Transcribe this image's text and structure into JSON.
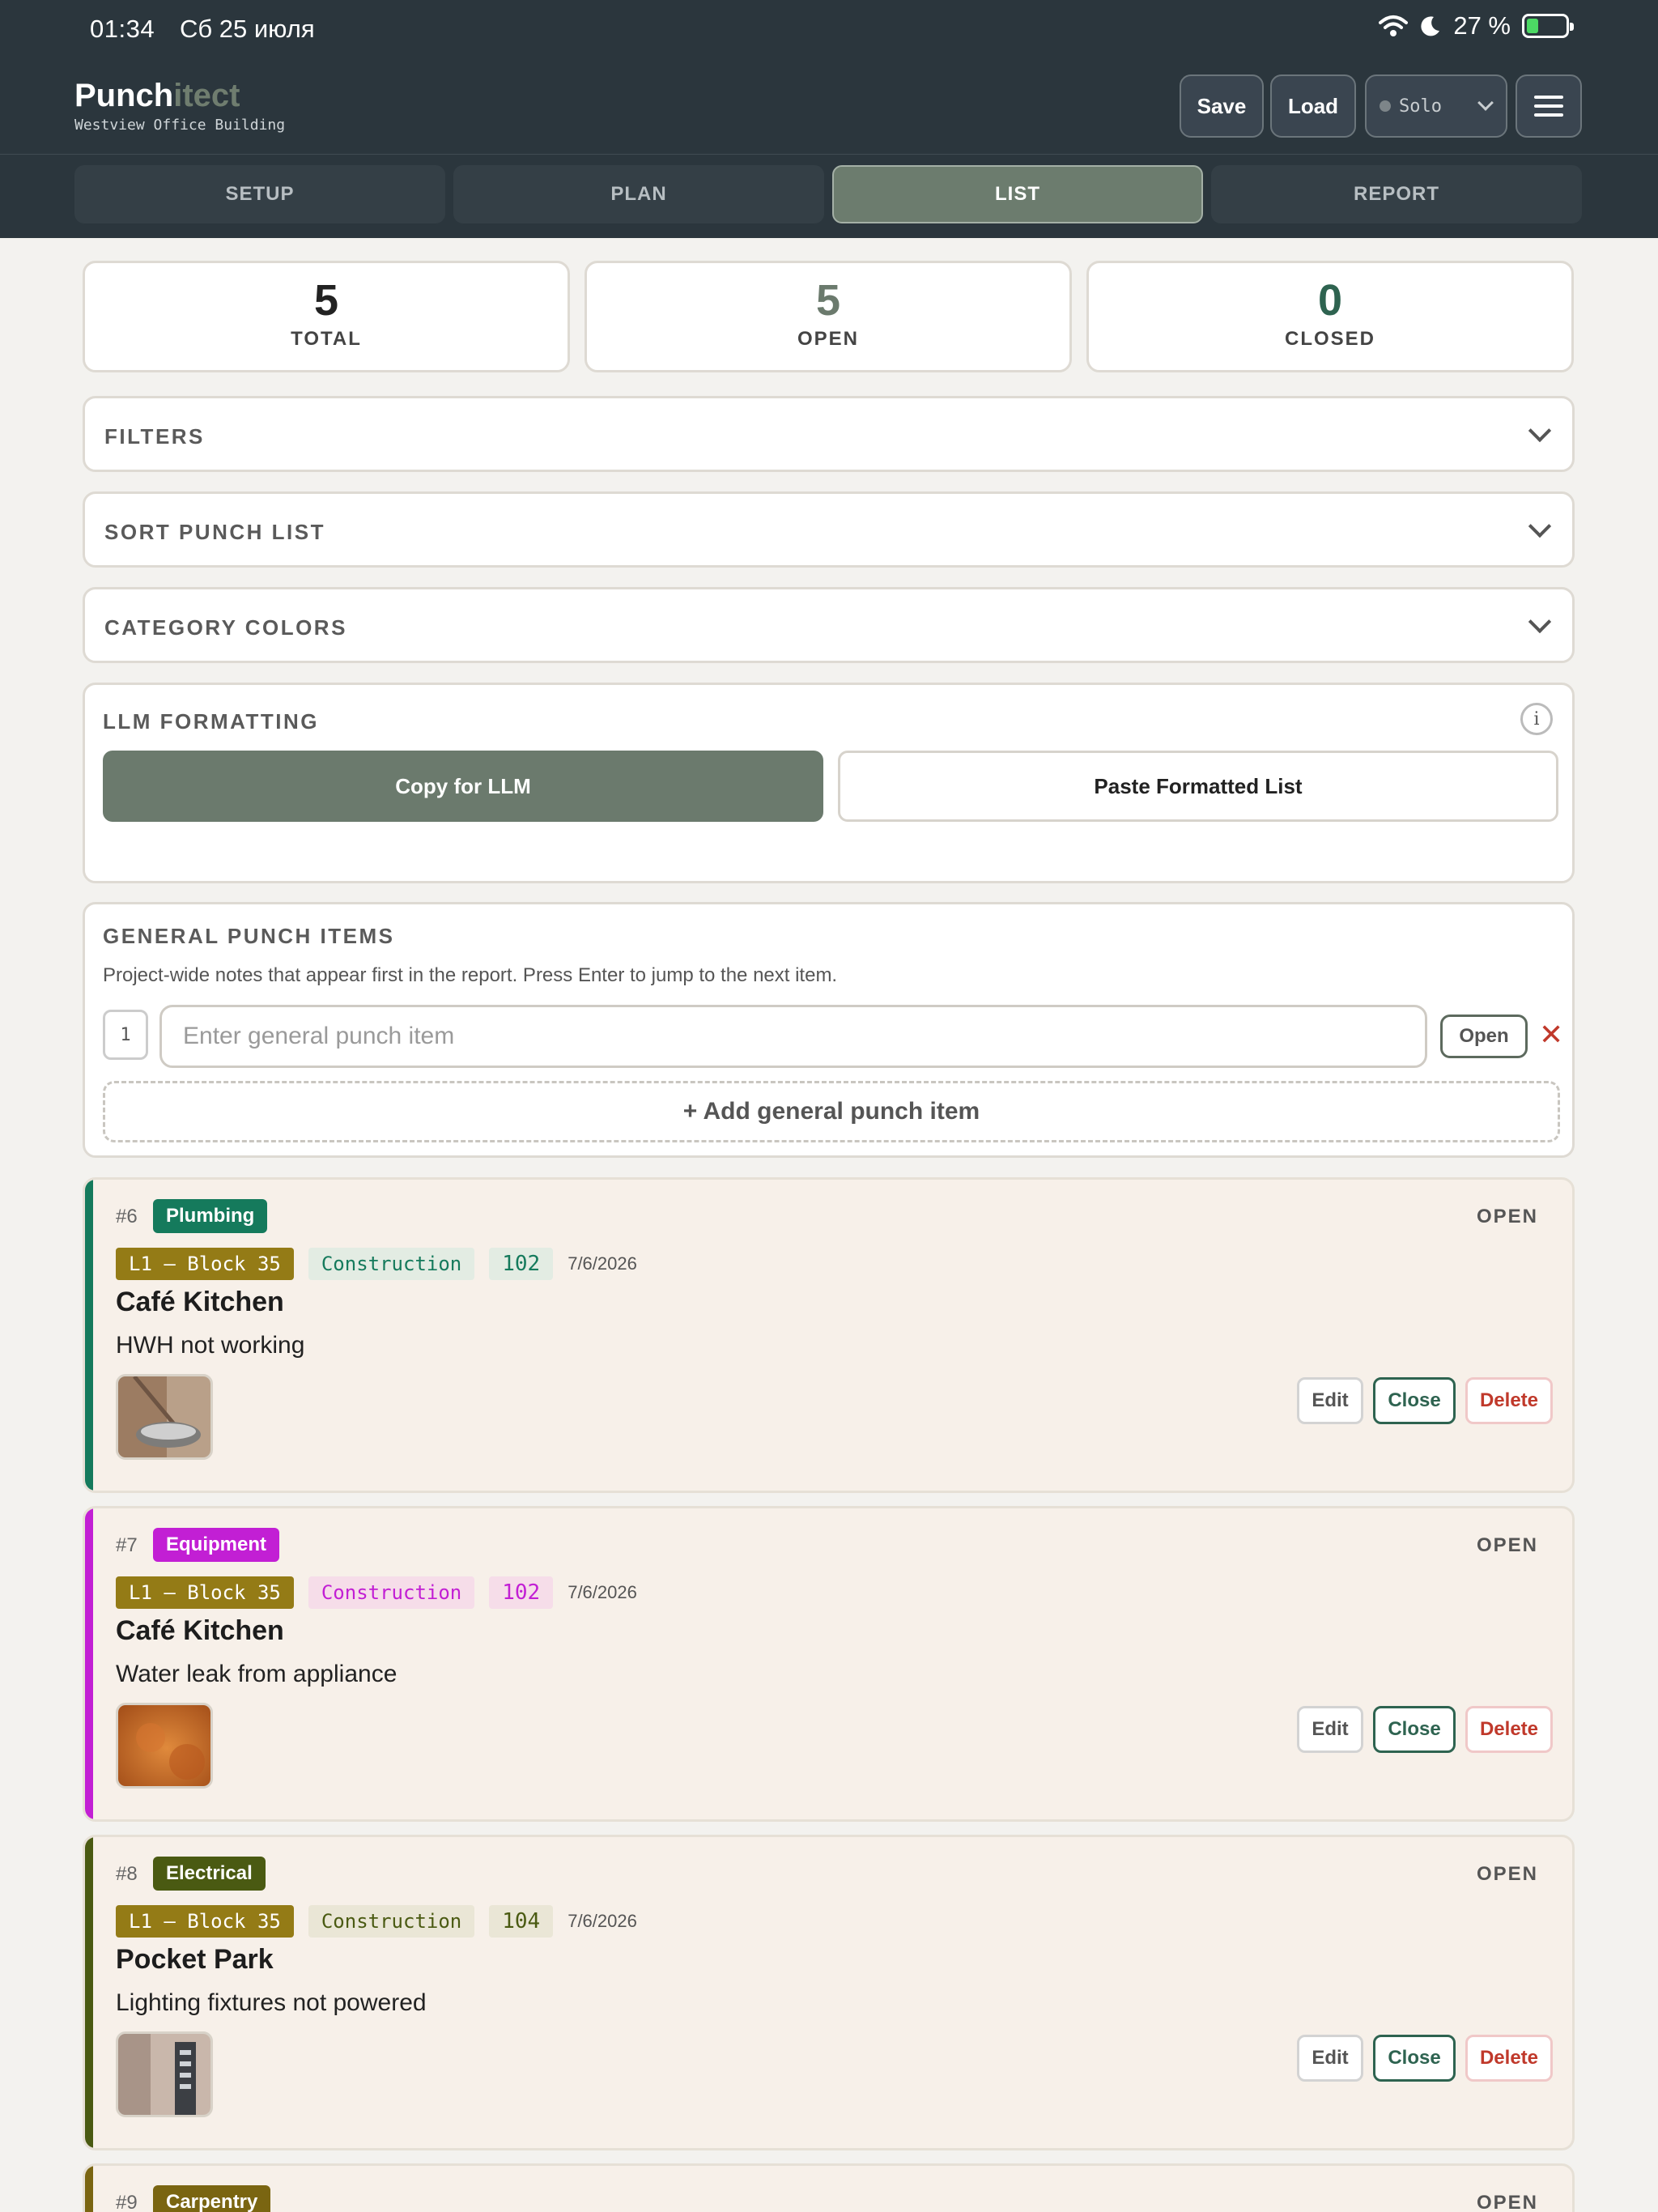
{
  "status": {
    "time": "01:34",
    "date": "Сб 25 июля",
    "battery": "27 %"
  },
  "header": {
    "brand_a": "Punch",
    "brand_b": "itect",
    "subtitle": "Westview Office Building",
    "save": "Save",
    "load": "Load",
    "mode": "Solo"
  },
  "tabs": [
    "SETUP",
    "PLAN",
    "LIST",
    "REPORT"
  ],
  "active_tab": "LIST",
  "stats": [
    {
      "value": "5",
      "label": "TOTAL",
      "color": "#222222"
    },
    {
      "value": "5",
      "label": "OPEN",
      "color": "#6b7a6d"
    },
    {
      "value": "0",
      "label": "CLOSED",
      "color": "#2e6350"
    }
  ],
  "sections": {
    "filters": "FILTERS",
    "sort": "SORT PUNCH LIST",
    "colors": "CATEGORY COLORS"
  },
  "llm": {
    "title": "LLM FORMATTING",
    "info": "i",
    "copy": "Copy for LLM",
    "paste": "Paste Formatted List"
  },
  "general": {
    "title": "GENERAL PUNCH ITEMS",
    "desc": "Project-wide notes that appear first in the report. Press Enter to jump to the next item.",
    "index": "1",
    "placeholder": "Enter general punch item",
    "status": "Open",
    "remove": "✕",
    "add": "+ Add general punch item"
  },
  "actions": {
    "edit": "Edit",
    "close": "Close",
    "delete": "Delete"
  },
  "items": [
    {
      "id": "#6",
      "category": "Plumbing",
      "color": "#157a5c",
      "chip_bg": "#e3ece3",
      "status": "OPEN",
      "location": "L1 – Block 35",
      "phase": "Construction",
      "room": "102",
      "date": "7/6/2026",
      "name": "Café Kitchen",
      "desc": "HWH not working"
    },
    {
      "id": "#7",
      "category": "Equipment",
      "color": "#c21fd4",
      "chip_bg": "#f6dde9",
      "status": "OPEN",
      "location": "L1 – Block 35",
      "phase": "Construction",
      "room": "102",
      "date": "7/6/2026",
      "name": "Café Kitchen",
      "desc": "Water leak from appliance"
    },
    {
      "id": "#8",
      "category": "Electrical",
      "color": "#4a5a12",
      "chip_bg": "#eae6d6",
      "status": "OPEN",
      "location": "L1 – Block 35",
      "phase": "Construction",
      "room": "104",
      "date": "7/6/2026",
      "name": "Pocket Park",
      "desc": "Lighting fixtures not powered"
    },
    {
      "id": "#9",
      "category": "Carpentry",
      "color": "#7a6511",
      "chip_bg": "#eee6d2",
      "status": "OPEN"
    }
  ]
}
